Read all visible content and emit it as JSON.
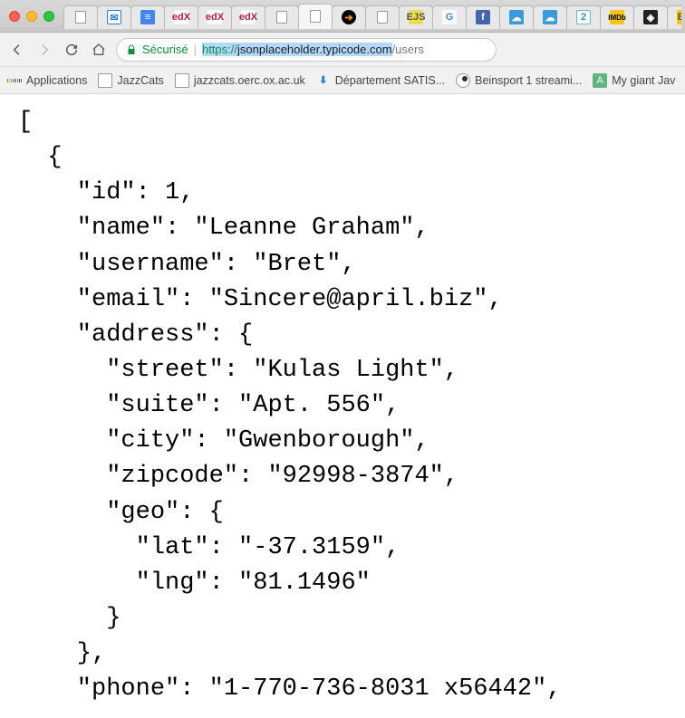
{
  "tabs": [
    {
      "icon": "page",
      "active": false
    },
    {
      "icon": "mail",
      "active": false
    },
    {
      "icon": "doc",
      "active": false
    },
    {
      "icon": "edx",
      "active": false
    },
    {
      "icon": "edx",
      "active": false
    },
    {
      "icon": "edx",
      "active": false
    },
    {
      "icon": "page",
      "active": false
    },
    {
      "icon": "page",
      "active": true
    },
    {
      "icon": "curl",
      "active": false
    },
    {
      "icon": "page",
      "active": false
    },
    {
      "icon": "ejs",
      "active": false
    },
    {
      "icon": "gt",
      "active": false
    },
    {
      "icon": "fb",
      "active": false
    },
    {
      "icon": "cloud",
      "active": false
    },
    {
      "icon": "cloud",
      "active": false
    },
    {
      "icon": "2",
      "active": false
    },
    {
      "icon": "imdb",
      "active": false
    },
    {
      "icon": "cp",
      "active": false
    },
    {
      "icon": "es",
      "active": false
    }
  ],
  "address": {
    "secure_label": "Sécurisé",
    "protocol": "https://",
    "host": "jsonplaceholder.typicode.com",
    "path": "/users"
  },
  "bookmarks": {
    "apps": "Applications",
    "items": [
      {
        "icon": "page",
        "label": "JazzCats"
      },
      {
        "icon": "page",
        "label": "jazzcats.oerc.ox.ac.uk"
      },
      {
        "icon": "dl",
        "label": "Département SATIS..."
      },
      {
        "icon": "bein",
        "label": "Beinsport 1 streami..."
      },
      {
        "icon": "atom",
        "label": "My giant Jav"
      }
    ]
  },
  "json_body": "[\n  {\n    \"id\": 1,\n    \"name\": \"Leanne Graham\",\n    \"username\": \"Bret\",\n    \"email\": \"Sincere@april.biz\",\n    \"address\": {\n      \"street\": \"Kulas Light\",\n      \"suite\": \"Apt. 556\",\n      \"city\": \"Gwenborough\",\n      \"zipcode\": \"92998-3874\",\n      \"geo\": {\n        \"lat\": \"-37.3159\",\n        \"lng\": \"81.1496\"\n      }\n    },\n    \"phone\": \"1-770-736-8031 x56442\","
}
